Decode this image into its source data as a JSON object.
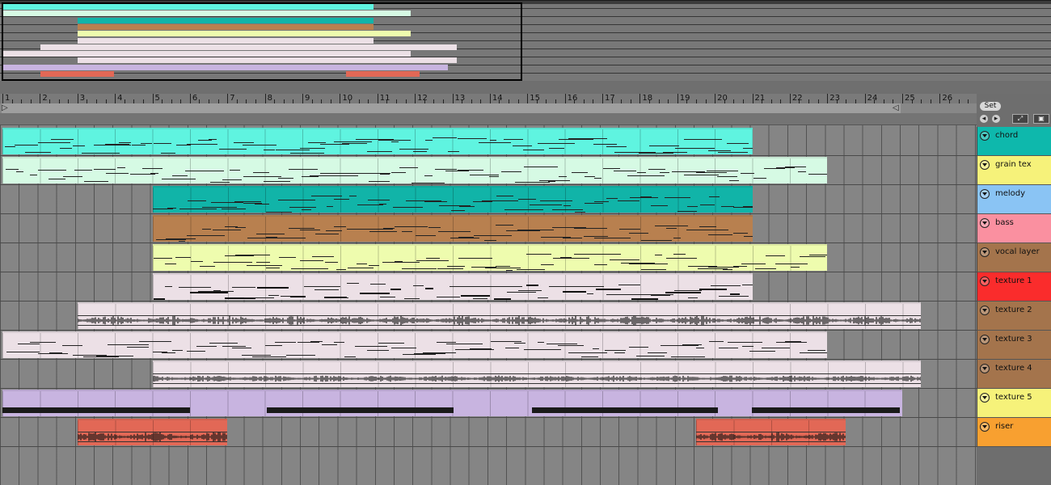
{
  "colors": {
    "chord": "#5ff4e0",
    "grain_tex": "#d6fae4",
    "melody": "#11b4a8",
    "bass": "#b8804f",
    "vocal_layer": "#eefcae",
    "texture_1": "#ece0e6",
    "texture_2": "#ece0e6",
    "texture_3": "#ece0e6",
    "texture_4": "#ece0e6",
    "texture_5": "#c8b4e0",
    "riser": "#e26856"
  },
  "ruler": {
    "bars": [
      "1",
      "2",
      "3",
      "4",
      "5",
      "6",
      "7",
      "8",
      "9",
      "10",
      "11",
      "12",
      "13",
      "14",
      "15",
      "16",
      "17",
      "18",
      "19",
      "20",
      "21",
      "22",
      "23",
      "24",
      "25",
      "26"
    ]
  },
  "controls": {
    "set_label": "Set",
    "prev_icon": "left-arrow-icon",
    "next_icon": "right-arrow-icon",
    "expand_icon": "expand-icon",
    "lock_icon": "lock-icon"
  },
  "tracks": [
    {
      "name": "chord",
      "head_color": "#0eb8ac",
      "clips": [
        {
          "start": 1,
          "end": 21,
          "color": "#5ff4e0",
          "kind": "midi"
        }
      ]
    },
    {
      "name": "grain tex",
      "head_color": "#f6f27a",
      "clips": [
        {
          "start": 1,
          "end": 23,
          "color": "#d6fae4",
          "kind": "midi"
        }
      ]
    },
    {
      "name": "melody",
      "head_color": "#8ac4f4",
      "clips": [
        {
          "start": 5,
          "end": 21,
          "color": "#11b4a8",
          "kind": "midi"
        }
      ]
    },
    {
      "name": "bass",
      "head_color": "#fa90a0",
      "clips": [
        {
          "start": 5,
          "end": 21,
          "color": "#b8804f",
          "kind": "midi"
        }
      ]
    },
    {
      "name": "vocal layer",
      "head_color": "#a4744c",
      "clips": [
        {
          "start": 5,
          "end": 23,
          "color": "#eefcae",
          "kind": "midi"
        }
      ]
    },
    {
      "name": "texture 1",
      "head_color": "#fa2c2c",
      "clips": [
        {
          "start": 5,
          "end": 21,
          "color": "#ece0e6",
          "kind": "midi"
        }
      ]
    },
    {
      "name": "texture 2",
      "head_color": "#a4744c",
      "clips": [
        {
          "start": 3,
          "end": 25.5,
          "color": "#ece0e6",
          "kind": "audio"
        }
      ]
    },
    {
      "name": "texture 3",
      "head_color": "#a4744c",
      "clips": [
        {
          "start": 1,
          "end": 23,
          "color": "#ece0e6",
          "kind": "midi"
        }
      ]
    },
    {
      "name": "texture 4",
      "head_color": "#a4744c",
      "clips": [
        {
          "start": 5,
          "end": 25.5,
          "color": "#ece0e6",
          "kind": "audio"
        }
      ]
    },
    {
      "name": "texture 5",
      "head_color": "#f6f27a",
      "clips": [
        {
          "start": 1,
          "end": 25,
          "color": "#c8b4e0",
          "kind": "blocks"
        }
      ]
    },
    {
      "name": "riser",
      "head_color": "#f8a030",
      "clips": [
        {
          "start": 3,
          "end": 7,
          "color": "#e26856",
          "kind": "audio"
        },
        {
          "start": 19.5,
          "end": 23.5,
          "color": "#e26856",
          "kind": "audio"
        }
      ]
    }
  ]
}
